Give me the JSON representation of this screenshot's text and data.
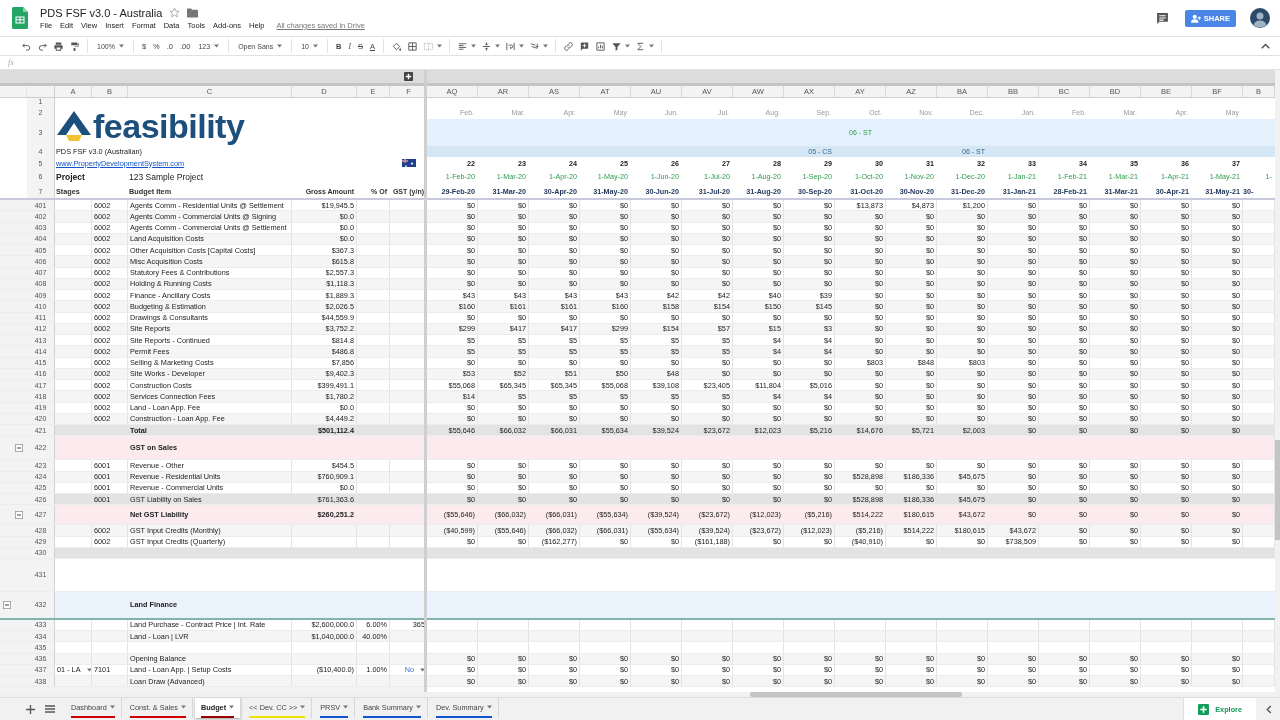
{
  "app": {
    "title": "PDS FSF v3.0 - Australia",
    "menu": [
      "File",
      "Edit",
      "View",
      "Insert",
      "Format",
      "Data",
      "Tools",
      "Add-ons",
      "Help"
    ],
    "save_status": "All changes saved in Drive",
    "share": "SHARE"
  },
  "toolbar": [
    [
      {
        "kind": "undo",
        "caret": false
      },
      {
        "kind": "redo",
        "caret": false
      },
      {
        "kind": "print",
        "caret": false
      },
      {
        "kind": "paint-format",
        "caret": false
      }
    ],
    [
      {
        "kind": "dropdown",
        "label": "100%",
        "caret": true
      }
    ],
    [
      {
        "kind": "text",
        "label": "$",
        "caret": false
      },
      {
        "kind": "text",
        "label": "%",
        "caret": false
      },
      {
        "kind": "text",
        "label": ".0",
        "caret": false
      },
      {
        "kind": "text",
        "label": ".00",
        "caret": false
      },
      {
        "kind": "dropdown",
        "label": "123",
        "caret": true
      }
    ],
    [
      {
        "kind": "dropdown",
        "label": "Open Sans",
        "caret": true
      }
    ],
    [
      {
        "kind": "dropdown",
        "label": "10",
        "caret": true
      }
    ],
    [
      {
        "kind": "bold",
        "label": "B",
        "caret": false
      },
      {
        "kind": "italic",
        "label": "I",
        "caret": false
      },
      {
        "kind": "strikethrough",
        "label": "S",
        "caret": false
      },
      {
        "kind": "text-color",
        "label": "A",
        "caret": false
      }
    ],
    [
      {
        "kind": "fill",
        "caret": false
      },
      {
        "kind": "borders",
        "caret": false
      },
      {
        "kind": "merge",
        "caret": true
      }
    ],
    [
      {
        "kind": "align",
        "caret": true
      },
      {
        "kind": "valign",
        "caret": true
      },
      {
        "kind": "wrap",
        "caret": true
      },
      {
        "kind": "rotate",
        "caret": true
      }
    ],
    [
      {
        "kind": "link",
        "caret": false
      },
      {
        "kind": "comment",
        "caret": false
      },
      {
        "kind": "chart",
        "caret": false
      },
      {
        "kind": "filter",
        "caret": true
      },
      {
        "kind": "sigma",
        "caret": true
      }
    ]
  ],
  "formula_bar": {
    "label": "fx"
  },
  "left_columns": [
    "A",
    "B",
    "C",
    "D",
    "E",
    "F"
  ],
  "right_columns": [
    "AQ",
    "AR",
    "AS",
    "AT",
    "AU",
    "AV",
    "AW",
    "AX",
    "AY",
    "AZ",
    "BA",
    "BB",
    "BC",
    "BD",
    "BE",
    "BF",
    "B"
  ],
  "frozen_row_numbers": [
    "1",
    "2",
    "3",
    "4",
    "5",
    "6",
    "7"
  ],
  "header": {
    "logo": "feasibility",
    "version": "PDS FSF v3.0 (Australian)",
    "website": "www.PropertyDevelopmentSystem.com",
    "project_label": "Project",
    "project_name": "123 Sample Project",
    "column_labels": [
      "Stages",
      "Budget Item",
      "Gross Amount",
      "% Of",
      "GST (y/n)"
    ],
    "months": [
      "Feb.",
      "Mar.",
      "Apr.",
      "May",
      "Jun.",
      "Jul.",
      "Aug.",
      "Sep.",
      "Oct.",
      "Nov.",
      "Dec.",
      "Jan.",
      "Feb.",
      "Mar.",
      "Apr.",
      "May"
    ],
    "periods": [
      {
        "number": "22",
        "start": "1-Feb-20",
        "end": "29-Feb-20"
      },
      {
        "number": "23",
        "start": "1-Mar-20",
        "end": "31-Mar-20"
      },
      {
        "number": "24",
        "start": "1-Apr-20",
        "end": "30-Apr-20"
      },
      {
        "number": "25",
        "start": "1-May-20",
        "end": "31-May-20"
      },
      {
        "number": "26",
        "start": "1-Jun-20",
        "end": "30-Jun-20"
      },
      {
        "number": "27",
        "start": "1-Jul-20",
        "end": "31-Jul-20"
      },
      {
        "number": "28",
        "start": "1-Aug-20",
        "end": "31-Aug-20"
      },
      {
        "number": "29",
        "stage_label": "05 - CS",
        "start": "1-Sep-20",
        "end": "30-Sep-20"
      },
      {
        "number": "30",
        "band_label": "06 - ST",
        "start": "1-Oct-20",
        "end": "31-Oct-20"
      },
      {
        "number": "31",
        "start": "1-Nov-20",
        "end": "30-Nov-20"
      },
      {
        "number": "32",
        "stage_label": "06 - ST",
        "start": "1-Dec-20",
        "end": "31-Dec-20"
      },
      {
        "number": "33",
        "start": "1-Jan-21",
        "end": "31-Jan-21"
      },
      {
        "number": "34",
        "start": "1-Feb-21",
        "end": "28-Feb-21"
      },
      {
        "number": "35",
        "start": "1-Mar-21",
        "end": "31-Mar-21"
      },
      {
        "number": "36",
        "start": "1-Apr-21",
        "end": "30-Apr-21"
      },
      {
        "number": "37",
        "start": "1-May-21",
        "end": "31-May-21"
      },
      {
        "start": "1-",
        "end": "30-"
      }
    ]
  },
  "rows": [
    {
      "n": "401",
      "kind": "item",
      "code": "6002",
      "item": "Agents Comm - Residential Units @ Settlement",
      "gross": "$19,945.5",
      "values": [
        "$0",
        "$0",
        "$0",
        "$0",
        "$0",
        "$0",
        "$0",
        "$0",
        "$13,873",
        "$4,873",
        "$1,200",
        "$0",
        "$0",
        "$0",
        "$0",
        "$0"
      ]
    },
    {
      "n": "402",
      "kind": "item",
      "code": "6002",
      "item": "Agents Comm - Commercial Units @ Signing",
      "gross": "$0.0",
      "values": [
        "$0",
        "$0",
        "$0",
        "$0",
        "$0",
        "$0",
        "$0",
        "$0",
        "$0",
        "$0",
        "$0",
        "$0",
        "$0",
        "$0",
        "$0",
        "$0"
      ]
    },
    {
      "n": "403",
      "kind": "item",
      "code": "6002",
      "item": "Agents Comm - Commercial Units @ Settlement",
      "gross": "$0.0",
      "values": [
        "$0",
        "$0",
        "$0",
        "$0",
        "$0",
        "$0",
        "$0",
        "$0",
        "$0",
        "$0",
        "$0",
        "$0",
        "$0",
        "$0",
        "$0",
        "$0"
      ]
    },
    {
      "n": "404",
      "kind": "item",
      "code": "6002",
      "item": "Land Acquisition Costs",
      "gross": "$0.0",
      "values": [
        "$0",
        "$0",
        "$0",
        "$0",
        "$0",
        "$0",
        "$0",
        "$0",
        "$0",
        "$0",
        "$0",
        "$0",
        "$0",
        "$0",
        "$0",
        "$0"
      ]
    },
    {
      "n": "405",
      "kind": "item",
      "code": "6002",
      "item": "Other Acquisition Costs [Capital Costs]",
      "gross": "$367.3",
      "values": [
        "$0",
        "$0",
        "$0",
        "$0",
        "$0",
        "$0",
        "$0",
        "$0",
        "$0",
        "$0",
        "$0",
        "$0",
        "$0",
        "$0",
        "$0",
        "$0"
      ]
    },
    {
      "n": "406",
      "kind": "item",
      "code": "6002",
      "item": "Misc Acquisition Costs",
      "gross": "$615.8",
      "values": [
        "$0",
        "$0",
        "$0",
        "$0",
        "$0",
        "$0",
        "$0",
        "$0",
        "$0",
        "$0",
        "$0",
        "$0",
        "$0",
        "$0",
        "$0",
        "$0"
      ]
    },
    {
      "n": "407",
      "kind": "item",
      "code": "6002",
      "item": "Statutory Fees & Contributions",
      "gross": "$2,557.3",
      "values": [
        "$0",
        "$0",
        "$0",
        "$0",
        "$0",
        "$0",
        "$0",
        "$0",
        "$0",
        "$0",
        "$0",
        "$0",
        "$0",
        "$0",
        "$0",
        "$0"
      ]
    },
    {
      "n": "408",
      "kind": "item",
      "code": "6002",
      "item": "Holding & Running Costs",
      "gross": "$1,118.3",
      "values": [
        "$0",
        "$0",
        "$0",
        "$0",
        "$0",
        "$0",
        "$0",
        "$0",
        "$0",
        "$0",
        "$0",
        "$0",
        "$0",
        "$0",
        "$0",
        "$0"
      ]
    },
    {
      "n": "409",
      "kind": "item",
      "code": "6002",
      "item": "Finance - Ancillary Costs",
      "gross": "$1,889.3",
      "values": [
        "$43",
        "$43",
        "$43",
        "$43",
        "$42",
        "$42",
        "$40",
        "$39",
        "$0",
        "$0",
        "$0",
        "$0",
        "$0",
        "$0",
        "$0",
        "$0"
      ]
    },
    {
      "n": "410",
      "kind": "item",
      "code": "6002",
      "item": "Budgeting & Estimation",
      "gross": "$2,026.5",
      "values": [
        "$160",
        "$161",
        "$161",
        "$160",
        "$158",
        "$154",
        "$150",
        "$145",
        "$0",
        "$0",
        "$0",
        "$0",
        "$0",
        "$0",
        "$0",
        "$0"
      ]
    },
    {
      "n": "411",
      "kind": "item",
      "code": "6002",
      "item": "Drawings & Consultants",
      "gross": "$44,559.9",
      "values": [
        "$0",
        "$0",
        "$0",
        "$0",
        "$0",
        "$0",
        "$0",
        "$0",
        "$0",
        "$0",
        "$0",
        "$0",
        "$0",
        "$0",
        "$0",
        "$0"
      ]
    },
    {
      "n": "412",
      "kind": "item",
      "code": "6002",
      "item": "Site Reports",
      "gross": "$3,752.2",
      "values": [
        "$299",
        "$417",
        "$417",
        "$299",
        "$154",
        "$57",
        "$15",
        "$3",
        "$0",
        "$0",
        "$0",
        "$0",
        "$0",
        "$0",
        "$0",
        "$0"
      ]
    },
    {
      "n": "413",
      "kind": "item",
      "code": "6002",
      "item": "Site Reports - Continued",
      "gross": "$814.8",
      "values": [
        "$5",
        "$5",
        "$5",
        "$5",
        "$5",
        "$5",
        "$4",
        "$4",
        "$0",
        "$0",
        "$0",
        "$0",
        "$0",
        "$0",
        "$0",
        "$0"
      ]
    },
    {
      "n": "414",
      "kind": "item",
      "code": "6002",
      "item": "Permit Fees",
      "gross": "$486.8",
      "values": [
        "$5",
        "$5",
        "$5",
        "$5",
        "$5",
        "$5",
        "$4",
        "$4",
        "$0",
        "$0",
        "$0",
        "$0",
        "$0",
        "$0",
        "$0",
        "$0"
      ]
    },
    {
      "n": "415",
      "kind": "item",
      "code": "6002",
      "item": "Selling & Marketing Costs",
      "gross": "$7,856",
      "values": [
        "$0",
        "$0",
        "$0",
        "$0",
        "$0",
        "$0",
        "$0",
        "$0",
        "$803",
        "$848",
        "$803",
        "$0",
        "$0",
        "$0",
        "$0",
        "$0"
      ]
    },
    {
      "n": "416",
      "kind": "item",
      "code": "6002",
      "item": "Site Works - Developer",
      "gross": "$9,402.3",
      "values": [
        "$53",
        "$52",
        "$51",
        "$50",
        "$48",
        "$0",
        "$0",
        "$0",
        "$0",
        "$0",
        "$0",
        "$0",
        "$0",
        "$0",
        "$0",
        "$0"
      ]
    },
    {
      "n": "417",
      "kind": "item",
      "code": "6002",
      "item": "Construction Costs",
      "gross": "$399,491.1",
      "values": [
        "$55,068",
        "$65,345",
        "$65,345",
        "$55,068",
        "$39,108",
        "$23,405",
        "$11,804",
        "$5,016",
        "$0",
        "$0",
        "$0",
        "$0",
        "$0",
        "$0",
        "$0",
        "$0"
      ]
    },
    {
      "n": "418",
      "kind": "item",
      "code": "6002",
      "item": "Services Connection Fees",
      "gross": "$1,780.2",
      "values": [
        "$14",
        "$5",
        "$5",
        "$5",
        "$5",
        "$5",
        "$4",
        "$4",
        "$0",
        "$0",
        "$0",
        "$0",
        "$0",
        "$0",
        "$0",
        "$0"
      ]
    },
    {
      "n": "419",
      "kind": "item",
      "code": "6002",
      "item": "Land - Loan App. Fee",
      "gross": "$0.0",
      "values": [
        "$0",
        "$0",
        "$0",
        "$0",
        "$0",
        "$0",
        "$0",
        "$0",
        "$0",
        "$0",
        "$0",
        "$0",
        "$0",
        "$0",
        "$0",
        "$0"
      ]
    },
    {
      "n": "420",
      "kind": "item",
      "code": "6002",
      "item": "Construction - Loan App. Fee",
      "gross": "$4,449.2",
      "values": [
        "$0",
        "$0",
        "$0",
        "$0",
        "$0",
        "$0",
        "$0",
        "$0",
        "$0",
        "$0",
        "$0",
        "$0",
        "$0",
        "$0",
        "$0",
        "$0"
      ]
    },
    {
      "n": "421",
      "kind": "total",
      "item": "Total",
      "gross": "$501,112.4",
      "values": [
        "$55,646",
        "$66,032",
        "$66,031",
        "$55,634",
        "$39,524",
        "$23,672",
        "$12,023",
        "$5,216",
        "$14,676",
        "$5,721",
        "$2,003",
        "$0",
        "$0",
        "$0",
        "$0",
        "$0"
      ]
    },
    {
      "n": "422",
      "kind": "section",
      "expanded": true,
      "item": "GST on Sales"
    },
    {
      "n": "423",
      "kind": "item",
      "code": "6001",
      "item": "Revenue - Other",
      "gross": "$454.5",
      "values": [
        "$0",
        "$0",
        "$0",
        "$0",
        "$0",
        "$0",
        "$0",
        "$0",
        "$0",
        "$0",
        "$0",
        "$0",
        "$0",
        "$0",
        "$0",
        "$0"
      ]
    },
    {
      "n": "424",
      "kind": "item",
      "code": "6001",
      "item": "Revenue - Residential Units",
      "gross": "$760,909.1",
      "values": [
        "$0",
        "$0",
        "$0",
        "$0",
        "$0",
        "$0",
        "$0",
        "$0",
        "$528,898",
        "$186,336",
        "$45,675",
        "$0",
        "$0",
        "$0",
        "$0",
        "$0"
      ]
    },
    {
      "n": "425",
      "kind": "item",
      "code": "6001",
      "item": "Revenue - Commercial Units",
      "gross": "$0.0",
      "values": [
        "$0",
        "$0",
        "$0",
        "$0",
        "$0",
        "$0",
        "$0",
        "$0",
        "$0",
        "$0",
        "$0",
        "$0",
        "$0",
        "$0",
        "$0",
        "$0"
      ]
    },
    {
      "n": "426",
      "kind": "subtotal",
      "code": "6001",
      "item": "GST Liability on Sales",
      "gross": "$761,363.6",
      "values": [
        "$0",
        "$0",
        "$0",
        "$0",
        "$0",
        "$0",
        "$0",
        "$0",
        "$528,898",
        "$186,336",
        "$45,675",
        "$0",
        "$0",
        "$0",
        "$0",
        "$0"
      ]
    },
    {
      "n": "427",
      "kind": "net",
      "expanded": true,
      "item": "Net GST Liability",
      "gross": "$260,251.2",
      "values": [
        "($55,646)",
        "($66,032)",
        "($66,031)",
        "($55,634)",
        "($39,524)",
        "($23,672)",
        "($12,023)",
        "($5,216)",
        "$514,222",
        "$180,615",
        "$43,672",
        "$0",
        "$0",
        "$0",
        "$0",
        "$0"
      ]
    },
    {
      "n": "428",
      "kind": "item",
      "code": "6002",
      "item": "GST Input Credits (Monthly)",
      "values": [
        "($40,599)",
        "($55,646)",
        "($66,032)",
        "($66,031)",
        "($55,634)",
        "($39,524)",
        "($23,672)",
        "($12,023)",
        "($5,216)",
        "$514,222",
        "$180,615",
        "$43,672",
        "$0",
        "$0",
        "$0",
        "$0"
      ]
    },
    {
      "n": "429",
      "kind": "item",
      "code": "6002",
      "item": "GST Input Credits (Quarterly)",
      "values": [
        "$0",
        "$0",
        "($162,277)",
        "$0",
        "$0",
        "($161,188)",
        "$0",
        "$0",
        "($40,910)",
        "$0",
        "$0",
        "$738,509",
        "$0",
        "$0",
        "$0",
        "$0"
      ]
    },
    {
      "n": "430",
      "kind": "spacer"
    },
    {
      "n": "431",
      "kind": "blank"
    },
    {
      "n": "432",
      "kind": "heading",
      "expanded": true,
      "item": "Land Finance"
    },
    {
      "n": "433",
      "kind": "item",
      "item": "Land Purchase - Contract Price | Int. Rate",
      "gross": "$2,600,000.0",
      "pct": "6.00%",
      "gst": "365"
    },
    {
      "n": "434",
      "kind": "item",
      "item": "Land - Loan | LVR",
      "gross": "$1,040,000.0",
      "pct": "40.00%"
    },
    {
      "n": "435",
      "kind": "item"
    },
    {
      "n": "436",
      "kind": "item",
      "item": "Opening Balance",
      "values": [
        "$0",
        "$0",
        "$0",
        "$0",
        "$0",
        "$0",
        "$0",
        "$0",
        "$0",
        "$0",
        "$0",
        "$0",
        "$0",
        "$0",
        "$0",
        "$0"
      ]
    },
    {
      "n": "437",
      "kind": "input",
      "stage": "01 - LA",
      "code": "7101",
      "item": "Land - Loan App. | Setup Costs",
      "gross": "($10,400.0)",
      "pct": "1.00%",
      "gst": "No",
      "values": [
        "$0",
        "$0",
        "$0",
        "$0",
        "$0",
        "$0",
        "$0",
        "$0",
        "$0",
        "$0",
        "$0",
        "$0",
        "$0",
        "$0",
        "$0",
        "$0"
      ]
    },
    {
      "n": "438",
      "kind": "item",
      "item": "Loan Draw (Advanced)",
      "values": [
        "$0",
        "$0",
        "$0",
        "$0",
        "$0",
        "$0",
        "$0",
        "$0",
        "$0",
        "$0",
        "$0",
        "$0",
        "$0",
        "$0",
        "$0",
        "$0"
      ]
    }
  ],
  "sheet_tabs": [
    {
      "label": "Dashboard",
      "color": "#cc0000",
      "selected": false
    },
    {
      "label": "Const. & Sales",
      "color": "#cc0000",
      "selected": false
    },
    {
      "label": "Budget",
      "color": "#990000",
      "selected": true
    },
    {
      "label": "<< Dev. CC >>",
      "color": "#f1e200",
      "selected": false
    },
    {
      "label": "PRSV",
      "color": "#1155cc",
      "selected": false
    },
    {
      "label": "Bank Summary",
      "color": "#1155cc",
      "selected": false
    },
    {
      "label": "Dev. Summary",
      "color": "#1155cc",
      "selected": false
    }
  ],
  "explore": "Explore"
}
